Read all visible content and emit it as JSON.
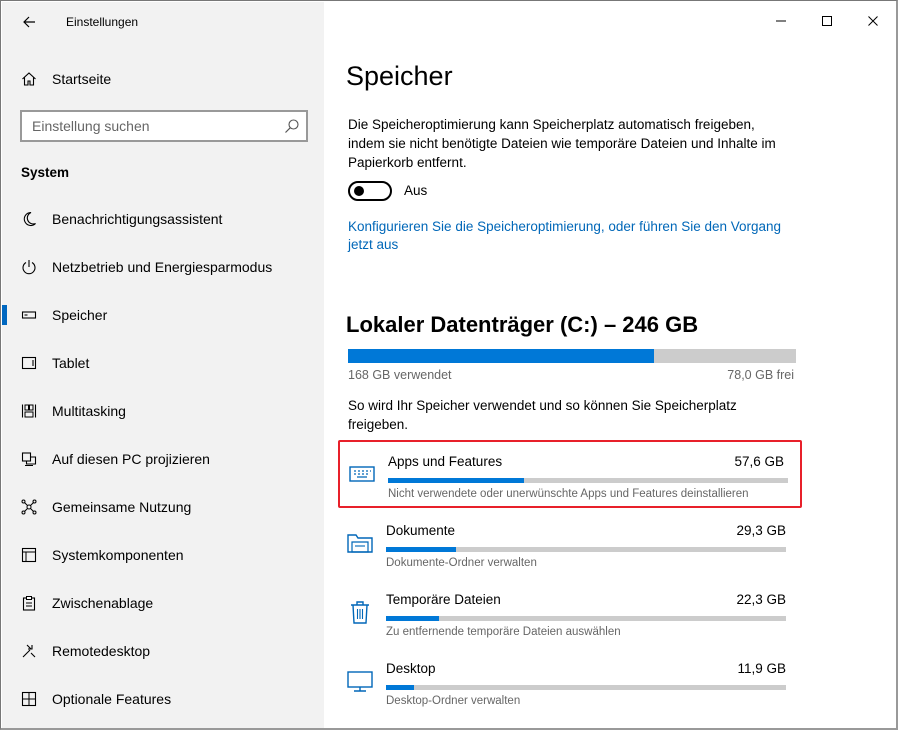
{
  "window": {
    "title": "Einstellungen"
  },
  "sidebar": {
    "home_label": "Startseite",
    "search_placeholder": "Einstellung suchen",
    "section_title": "System",
    "items": [
      {
        "label": "Benachrichtigungsassistent",
        "icon": "moon-icon"
      },
      {
        "label": "Netzbetrieb und Energiesparmodus",
        "icon": "power-icon"
      },
      {
        "label": "Speicher",
        "icon": "storage-icon",
        "active": true
      },
      {
        "label": "Tablet",
        "icon": "tablet-icon"
      },
      {
        "label": "Multitasking",
        "icon": "multitasking-icon"
      },
      {
        "label": "Auf diesen PC projizieren",
        "icon": "project-icon"
      },
      {
        "label": "Gemeinsame Nutzung",
        "icon": "share-icon"
      },
      {
        "label": "Systemkomponenten",
        "icon": "components-icon"
      },
      {
        "label": "Zwischenablage",
        "icon": "clipboard-icon"
      },
      {
        "label": "Remotedesktop",
        "icon": "remote-desktop-icon"
      },
      {
        "label": "Optionale Features",
        "icon": "optional-features-icon"
      }
    ]
  },
  "main": {
    "title": "Speicher",
    "description": "Die Speicheroptimierung kann Speicherplatz automatisch freigeben, indem sie nicht benötigte Dateien wie temporäre Dateien und Inhalte im Papierkorb entfernt.",
    "toggle_state": "Aus",
    "config_link": "Konfigurieren Sie die Speicheroptimierung, oder führen Sie den Vorgang jetzt aus",
    "drive": {
      "title": "Lokaler Datenträger (C:) – 246 GB",
      "used_label": "168 GB verwendet",
      "free_label": "78,0 GB frei",
      "used_fraction": 0.683
    },
    "usage_description": "So wird Ihr Speicher verwendet und so können Sie Speicherplatz freigeben.",
    "categories": [
      {
        "name": "Apps und Features",
        "size": "57,6 GB",
        "subtitle": "Nicht verwendete oder unerwünschte Apps und Features deinstallieren",
        "fraction": 0.34,
        "icon": "keyboard-icon",
        "highlighted": true
      },
      {
        "name": "Dokumente",
        "size": "29,3 GB",
        "subtitle": "Dokumente-Ordner verwalten",
        "fraction": 0.175,
        "icon": "folder-icon"
      },
      {
        "name": "Temporäre Dateien",
        "size": "22,3 GB",
        "subtitle": "Zu entfernende temporäre Dateien auswählen",
        "fraction": 0.133,
        "icon": "trash-icon"
      },
      {
        "name": "Desktop",
        "size": "11,9 GB",
        "subtitle": "Desktop-Ordner verwalten",
        "fraction": 0.071,
        "icon": "monitor-icon"
      }
    ]
  },
  "colors": {
    "accent": "#0078d7",
    "link": "#0067b8",
    "highlight": "#e8202a",
    "bar_background": "#cccccc"
  }
}
